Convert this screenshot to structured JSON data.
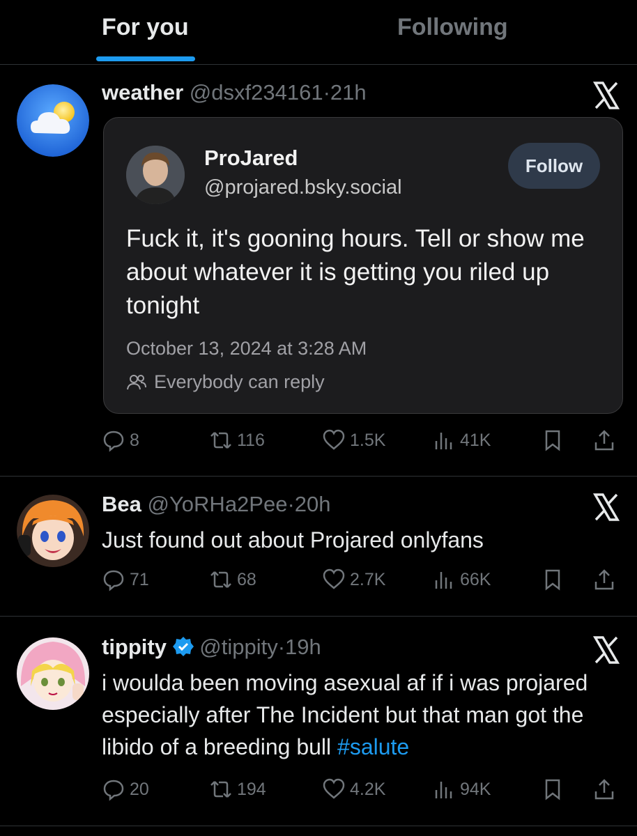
{
  "tabs": [
    {
      "label": "For you",
      "active": true
    },
    {
      "label": "Following",
      "active": false
    }
  ],
  "posts": [
    {
      "name": "weather",
      "handle": "@dsxf234161",
      "sep": "·",
      "time": "21h",
      "avatar_icon": "weather-cloud-sun-icon",
      "quote_card": {
        "name": "ProJared",
        "handle": "@projared.bsky.social",
        "follow_label": "Follow",
        "text": "Fuck it, it's gooning hours. Tell or show me about whatever it is getting you riled up tonight",
        "date": "October 13, 2024 at 3:28 AM",
        "reply_setting": "Everybody can reply"
      },
      "replies": "8",
      "reposts": "116",
      "likes": "1.5K",
      "views": "41K"
    },
    {
      "name": "Bea",
      "handle": "@YoRHa2Pee",
      "sep": "·",
      "time": "20h",
      "avatar_icon": "anime-avatar-orange-hair",
      "text": "Just found out about Projared onlyfans",
      "replies": "71",
      "reposts": "68",
      "likes": "2.7K",
      "views": "66K"
    },
    {
      "name": "tippity",
      "verified": true,
      "handle": "@tippity",
      "sep": "·",
      "time": "19h",
      "avatar_icon": "anime-avatar-pink-hood",
      "text": "i woulda been moving asexual af if i was projared especially after The Incident but that man got the libido of a breeding bull",
      "hashtag": "#salute",
      "replies": "20",
      "reposts": "194",
      "likes": "4.2K",
      "views": "94K"
    }
  ],
  "colors": {
    "accent": "#1d9bf0",
    "muted": "#71767b",
    "text": "#e7e9ea",
    "background": "#000000"
  }
}
